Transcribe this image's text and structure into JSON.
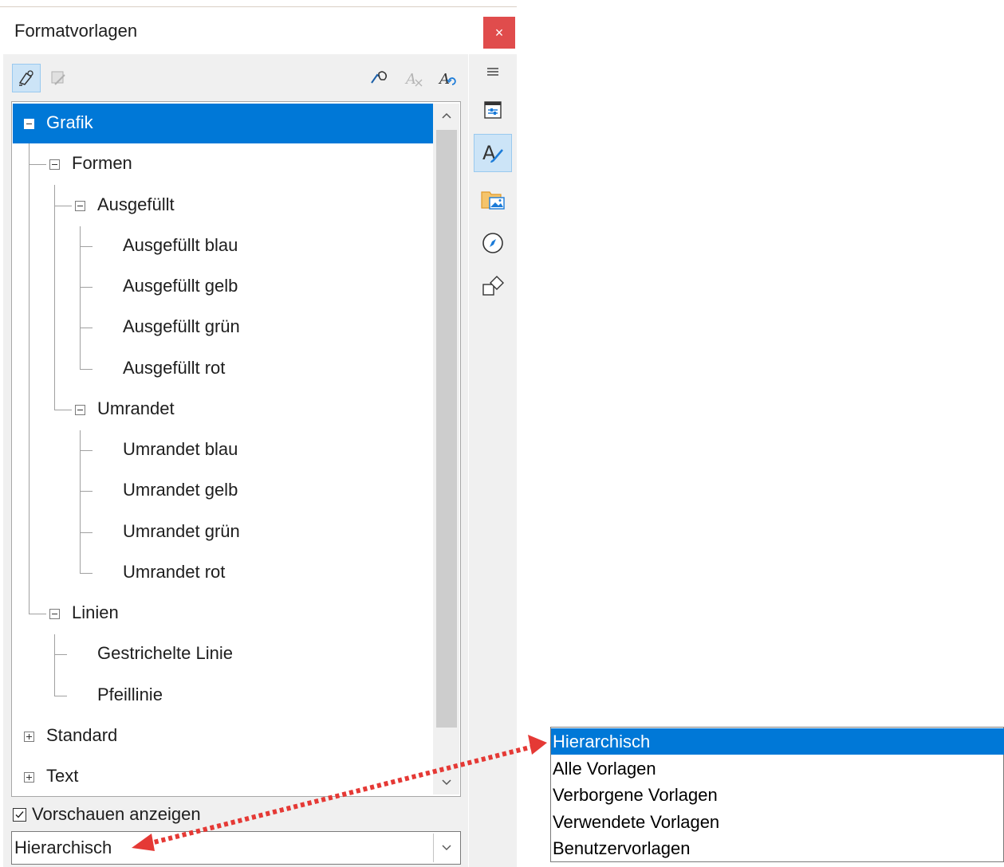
{
  "dialog": {
    "title": "Formatvorlagen",
    "close_glyph": "×"
  },
  "toolbar": {
    "fill_format_icon": "fill-format-icon",
    "fill_format2_icon": "fill-format-disabled-icon",
    "new_style_icon": "new-style-from-selection-icon",
    "update_style_icon": "update-style-icon",
    "load_styles_icon": "load-styles-icon"
  },
  "tree": {
    "items": [
      {
        "label": "Grafik",
        "level": 0,
        "expander": "minus",
        "selected": true
      },
      {
        "label": "Formen",
        "level": 1,
        "expander": "minus"
      },
      {
        "label": "Ausgefüllt",
        "level": 2,
        "expander": "minus"
      },
      {
        "label": "Ausgefüllt blau",
        "level": 3
      },
      {
        "label": "Ausgefüllt gelb",
        "level": 3
      },
      {
        "label": "Ausgefüllt grün",
        "level": 3
      },
      {
        "label": "Ausgefüllt rot",
        "level": 3
      },
      {
        "label": "Umrandet",
        "level": 2,
        "expander": "minus"
      },
      {
        "label": "Umrandet blau",
        "level": 3
      },
      {
        "label": "Umrandet gelb",
        "level": 3
      },
      {
        "label": "Umrandet grün",
        "level": 3
      },
      {
        "label": "Umrandet rot",
        "level": 3
      },
      {
        "label": "Linien",
        "level": 1,
        "expander": "minus"
      },
      {
        "label": "Gestrichelte Linie",
        "level": 2
      },
      {
        "label": "Pfeillinie",
        "level": 2
      },
      {
        "label": "Standard",
        "level": 0,
        "expander": "plus"
      },
      {
        "label": "Text",
        "level": 0,
        "expander": "plus"
      }
    ]
  },
  "preview": {
    "label": "Vorschauen anzeigen",
    "checked": true
  },
  "filter_select": {
    "value": "Hierarchisch"
  },
  "sidebar_tabs": [
    "menu-icon",
    "properties-icon",
    "styles-icon",
    "gallery-icon",
    "navigator-icon",
    "shapes-icon"
  ],
  "dropdown": {
    "options": [
      "Hierarchisch",
      "Alle Vorlagen",
      "Verborgene Vorlagen",
      "Verwendete Vorlagen",
      "Benutzervorlagen"
    ],
    "selected_index": 0
  },
  "colors": {
    "selection": "#0078d7",
    "close": "#e04c4c",
    "arrow": "#e53935"
  }
}
